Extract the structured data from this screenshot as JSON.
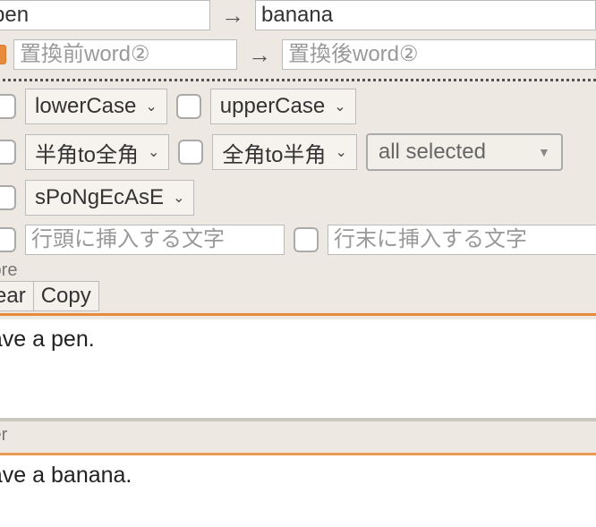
{
  "replace": {
    "rows": [
      {
        "before_value": "pen",
        "before_placeholder": "",
        "after_value": "banana",
        "after_placeholder": ""
      },
      {
        "before_value": "",
        "before_placeholder": "置換前word②",
        "after_value": "",
        "after_placeholder": "置換後word②"
      }
    ],
    "arrow": "→"
  },
  "options": {
    "lowercase": "lowerCase",
    "uppercase": "upperCase",
    "halftofull": "半角to全角",
    "fulltohalf": "全角to半角",
    "spongecase": "sPoNgEcAsE",
    "allselected": "all selected"
  },
  "lineInsert": {
    "head_placeholder": "行頭に挿入する文字",
    "tail_placeholder": "行末に挿入する文字"
  },
  "labels": {
    "before": "fore",
    "after": "ter"
  },
  "buttons": {
    "clear": "ear",
    "copy": "Copy"
  },
  "texts": {
    "before": "have a pen.",
    "after": "have a banana."
  }
}
